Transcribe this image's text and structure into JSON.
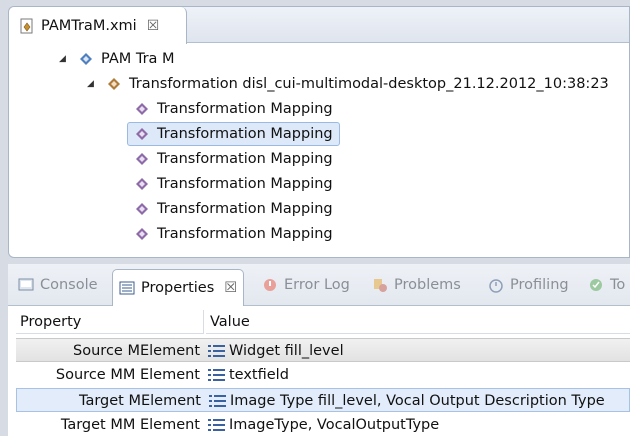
{
  "editor": {
    "tab_label": "PAMTraM.xmi",
    "tab_close": "☒"
  },
  "tree": {
    "root_label": "PAM Tra M",
    "transformation_label": "Transformation disl_cui-multimodal-desktop_21.12.2012_10:38:23",
    "mappings": [
      "Transformation Mapping",
      "Transformation Mapping",
      "Transformation Mapping",
      "Transformation Mapping",
      "Transformation Mapping",
      "Transformation Mapping"
    ],
    "selected_index": 1
  },
  "views": {
    "tabs": [
      {
        "label": "Console",
        "icon": "console-icon"
      },
      {
        "label": "Properties",
        "icon": "properties-icon",
        "active": true
      },
      {
        "label": "Error Log",
        "icon": "error-log-icon"
      },
      {
        "label": "Problems",
        "icon": "problems-icon"
      },
      {
        "label": "Profiling",
        "icon": "profiling-icon"
      },
      {
        "label": "To",
        "icon": "tasks-icon"
      }
    ],
    "properties_close": "☒"
  },
  "properties": {
    "header_property": "Property",
    "header_value": "Value",
    "rows": [
      {
        "key": "Source MElement",
        "value": "Widget fill_level"
      },
      {
        "key": "Source MM Element",
        "value": "textfield"
      },
      {
        "key": "Target MElement",
        "value": "Image Type fill_level, Vocal Output Description Type"
      },
      {
        "key": "Target MM Element",
        "value": "ImageType, VocalOutputType"
      }
    ]
  },
  "colors": {
    "selection_bg": "#dde8f8",
    "selection_border": "#9bbae3",
    "diamond_purple": "#8e6aa8",
    "diamond_brown": "#b07a3a",
    "diamond_blue": "#4f7fbf"
  }
}
